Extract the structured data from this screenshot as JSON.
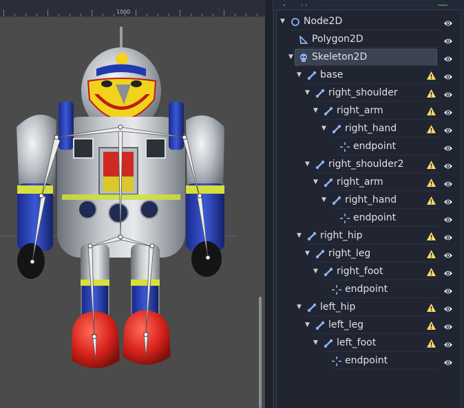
{
  "viewport": {
    "ruler_label": "1000",
    "robot_image": "tin-robot-sprite"
  },
  "scene_dock": {
    "filter_placeholder": "Filter nodes",
    "nodes": [
      {
        "label": "Node2D",
        "icon": "node2d-icon",
        "depth": 0,
        "expanded": true,
        "warning": false,
        "selected": false
      },
      {
        "label": "Polygon2D",
        "icon": "polygon2d-icon",
        "depth": 1,
        "expanded": null,
        "warning": false,
        "selected": false
      },
      {
        "label": "Skeleton2D",
        "icon": "skeleton2d-icon",
        "depth": 1,
        "expanded": true,
        "warning": false,
        "selected": true
      },
      {
        "label": "base",
        "icon": "bone2d-icon",
        "depth": 2,
        "expanded": true,
        "warning": true,
        "selected": false
      },
      {
        "label": "right_shoulder",
        "icon": "bone2d-icon",
        "depth": 3,
        "expanded": true,
        "warning": true,
        "selected": false
      },
      {
        "label": "right_arm",
        "icon": "bone2d-icon",
        "depth": 4,
        "expanded": true,
        "warning": true,
        "selected": false
      },
      {
        "label": "right_hand",
        "icon": "bone2d-icon",
        "depth": 5,
        "expanded": true,
        "warning": true,
        "selected": false
      },
      {
        "label": "endpoint",
        "icon": "position2d-icon",
        "depth": 6,
        "expanded": null,
        "warning": false,
        "selected": false
      },
      {
        "label": "right_shoulder2",
        "icon": "bone2d-icon",
        "depth": 3,
        "expanded": true,
        "warning": true,
        "selected": false
      },
      {
        "label": "right_arm",
        "icon": "bone2d-icon",
        "depth": 4,
        "expanded": true,
        "warning": true,
        "selected": false
      },
      {
        "label": "right_hand",
        "icon": "bone2d-icon",
        "depth": 5,
        "expanded": true,
        "warning": true,
        "selected": false
      },
      {
        "label": "endpoint",
        "icon": "position2d-icon",
        "depth": 6,
        "expanded": null,
        "warning": false,
        "selected": false
      },
      {
        "label": "right_hip",
        "icon": "bone2d-icon",
        "depth": 2,
        "expanded": true,
        "warning": true,
        "selected": false
      },
      {
        "label": "right_leg",
        "icon": "bone2d-icon",
        "depth": 3,
        "expanded": true,
        "warning": true,
        "selected": false
      },
      {
        "label": "right_foot",
        "icon": "bone2d-icon",
        "depth": 4,
        "expanded": true,
        "warning": true,
        "selected": false
      },
      {
        "label": "endpoint",
        "icon": "position2d-icon",
        "depth": 5,
        "expanded": null,
        "warning": false,
        "selected": false
      },
      {
        "label": "left_hip",
        "icon": "bone2d-icon",
        "depth": 2,
        "expanded": true,
        "warning": true,
        "selected": false
      },
      {
        "label": "left_leg",
        "icon": "bone2d-icon",
        "depth": 3,
        "expanded": true,
        "warning": true,
        "selected": false
      },
      {
        "label": "left_foot",
        "icon": "bone2d-icon",
        "depth": 4,
        "expanded": true,
        "warning": true,
        "selected": false
      },
      {
        "label": "endpoint",
        "icon": "position2d-icon",
        "depth": 5,
        "expanded": null,
        "warning": false,
        "selected": false
      }
    ]
  },
  "colors": {
    "accent": "#8eb4f0",
    "warning": "#ffdd65",
    "bone": "#e8e8e8"
  }
}
